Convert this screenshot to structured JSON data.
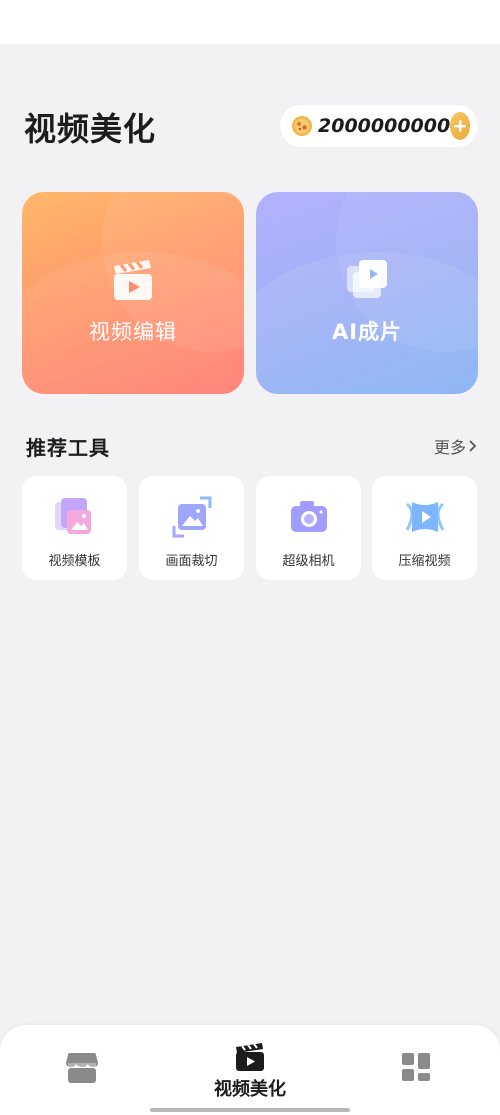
{
  "header": {
    "title": "视频美化",
    "coins": "2000000000"
  },
  "cards": [
    {
      "label": "视频编辑",
      "icon": "clapperboard-icon"
    },
    {
      "label": "AI成片",
      "icon": "stacked-video-icon"
    }
  ],
  "tools_section": {
    "title": "推荐工具",
    "more_label": "更多"
  },
  "tools": [
    {
      "label": "视频模板",
      "icon": "template-icon"
    },
    {
      "label": "画面裁切",
      "icon": "crop-icon"
    },
    {
      "label": "超级相机",
      "icon": "camera-icon"
    },
    {
      "label": "压缩视频",
      "icon": "compress-video-icon"
    }
  ],
  "bottom_nav": {
    "active_label": "视频美化",
    "items": [
      {
        "icon": "store-icon"
      },
      {
        "icon": "clapperboard-icon",
        "label": "视频美化"
      },
      {
        "icon": "apps-grid-icon"
      }
    ]
  },
  "colors": {
    "background": "#f2f2f4",
    "edit_card_gradient": [
      "#ffb86b",
      "#ff7b72"
    ],
    "ai_card_gradient": [
      "#b3b1ff",
      "#85b1f4"
    ],
    "coin_add": "#f0b646"
  }
}
